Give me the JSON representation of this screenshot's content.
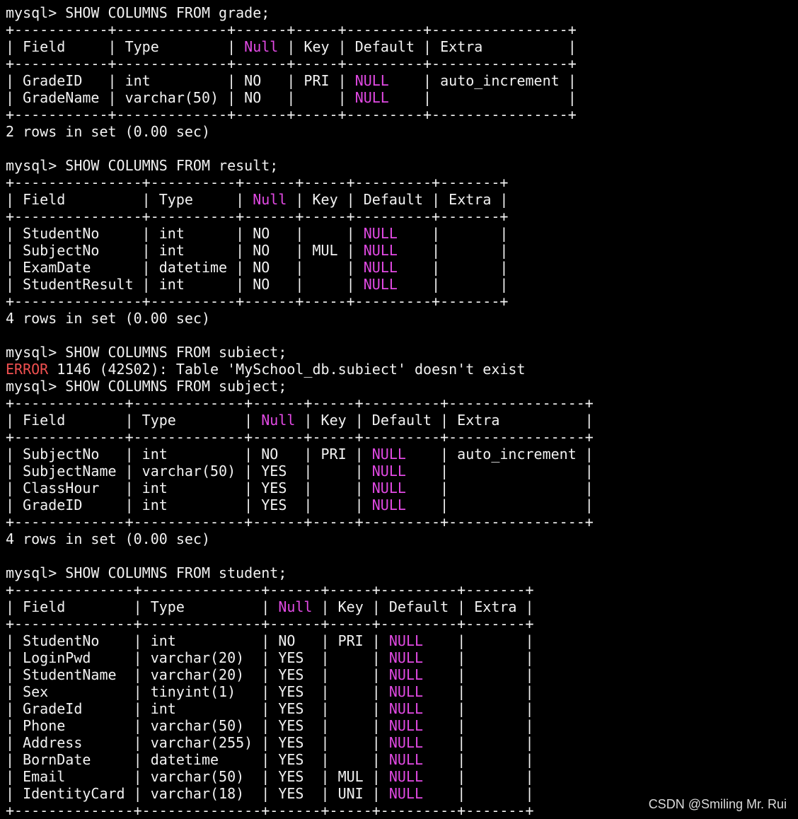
{
  "colors": {
    "background": "#000000",
    "text": "#f2f2f2",
    "null_highlight": "#e24ae4",
    "error_highlight": "#f05050"
  },
  "lines": [
    [
      {
        "t": "mysql> SHOW COLUMNS FROM grade;"
      }
    ],
    [
      {
        "t": "+-----------+-------------+------+-----+---------+----------------+"
      }
    ],
    [
      {
        "t": "| Field     | Type        | "
      },
      {
        "t": "Null",
        "c": "magenta"
      },
      {
        "t": " | Key | Default | Extra          |"
      }
    ],
    [
      {
        "t": "+-----------+-------------+------+-----+---------+----------------+"
      }
    ],
    [
      {
        "t": "| GradeID   | int         | NO   | PRI | "
      },
      {
        "t": "NULL",
        "c": "magenta"
      },
      {
        "t": "    | auto_increment |"
      }
    ],
    [
      {
        "t": "| GradeName | varchar(50) | NO   |     | "
      },
      {
        "t": "NULL",
        "c": "magenta"
      },
      {
        "t": "    |                |"
      }
    ],
    [
      {
        "t": "+-----------+-------------+------+-----+---------+----------------+"
      }
    ],
    [
      {
        "t": "2 rows in set (0.00 sec)"
      }
    ],
    [
      {
        "t": ""
      }
    ],
    [
      {
        "t": "mysql> SHOW COLUMNS FROM result;"
      }
    ],
    [
      {
        "t": "+---------------+----------+------+-----+---------+-------+"
      }
    ],
    [
      {
        "t": "| Field         | Type     | "
      },
      {
        "t": "Null",
        "c": "magenta"
      },
      {
        "t": " | Key | Default | Extra |"
      }
    ],
    [
      {
        "t": "+---------------+----------+------+-----+---------+-------+"
      }
    ],
    [
      {
        "t": "| StudentNo     | int      | NO   |     | "
      },
      {
        "t": "NULL",
        "c": "magenta"
      },
      {
        "t": "    |       |"
      }
    ],
    [
      {
        "t": "| SubjectNo     | int      | NO   | MUL | "
      },
      {
        "t": "NULL",
        "c": "magenta"
      },
      {
        "t": "    |       |"
      }
    ],
    [
      {
        "t": "| ExamDate      | datetime | NO   |     | "
      },
      {
        "t": "NULL",
        "c": "magenta"
      },
      {
        "t": "    |       |"
      }
    ],
    [
      {
        "t": "| StudentResult | int      | NO   |     | "
      },
      {
        "t": "NULL",
        "c": "magenta"
      },
      {
        "t": "    |       |"
      }
    ],
    [
      {
        "t": "+---------------+----------+------+-----+---------+-------+"
      }
    ],
    [
      {
        "t": "4 rows in set (0.00 sec)"
      }
    ],
    [
      {
        "t": ""
      }
    ],
    [
      {
        "t": "mysql> SHOW COLUMNS FROM subiect;"
      }
    ],
    [
      {
        "t": "ERROR",
        "c": "err-red"
      },
      {
        "t": " 1146 (42S02): Table 'MySchool_db.subiect' doesn't exist"
      }
    ],
    [
      {
        "t": "mysql> SHOW COLUMNS FROM subject;"
      }
    ],
    [
      {
        "t": "+-------------+-------------+------+-----+---------+----------------+"
      }
    ],
    [
      {
        "t": "| Field       | Type        | "
      },
      {
        "t": "Null",
        "c": "magenta"
      },
      {
        "t": " | Key | Default | Extra          |"
      }
    ],
    [
      {
        "t": "+-------------+-------------+------+-----+---------+----------------+"
      }
    ],
    [
      {
        "t": "| SubjectNo   | int         | NO   | PRI | "
      },
      {
        "t": "NULL",
        "c": "magenta"
      },
      {
        "t": "    | auto_increment |"
      }
    ],
    [
      {
        "t": "| SubjectName | varchar(50) | YES  |     | "
      },
      {
        "t": "NULL",
        "c": "magenta"
      },
      {
        "t": "    |                |"
      }
    ],
    [
      {
        "t": "| ClassHour   | int         | YES  |     | "
      },
      {
        "t": "NULL",
        "c": "magenta"
      },
      {
        "t": "    |                |"
      }
    ],
    [
      {
        "t": "| GradeID     | int         | YES  |     | "
      },
      {
        "t": "NULL",
        "c": "magenta"
      },
      {
        "t": "    |                |"
      }
    ],
    [
      {
        "t": "+-------------+-------------+------+-----+---------+----------------+"
      }
    ],
    [
      {
        "t": "4 rows in set (0.00 sec)"
      }
    ],
    [
      {
        "t": ""
      }
    ],
    [
      {
        "t": "mysql> SHOW COLUMNS FROM student;"
      }
    ],
    [
      {
        "t": "+--------------+--------------+------+-----+---------+-------+"
      }
    ],
    [
      {
        "t": "| Field        | Type         | "
      },
      {
        "t": "Null",
        "c": "magenta"
      },
      {
        "t": " | Key | Default | Extra |"
      }
    ],
    [
      {
        "t": "+--------------+--------------+------+-----+---------+-------+"
      }
    ],
    [
      {
        "t": "| StudentNo    | int          | NO   | PRI | "
      },
      {
        "t": "NULL",
        "c": "magenta"
      },
      {
        "t": "    |       |"
      }
    ],
    [
      {
        "t": "| LoginPwd     | varchar(20)  | YES  |     | "
      },
      {
        "t": "NULL",
        "c": "magenta"
      },
      {
        "t": "    |       |"
      }
    ],
    [
      {
        "t": "| StudentName  | varchar(20)  | YES  |     | "
      },
      {
        "t": "NULL",
        "c": "magenta"
      },
      {
        "t": "    |       |"
      }
    ],
    [
      {
        "t": "| Sex          | tinyint(1)   | YES  |     | "
      },
      {
        "t": "NULL",
        "c": "magenta"
      },
      {
        "t": "    |       |"
      }
    ],
    [
      {
        "t": "| GradeId      | int          | YES  |     | "
      },
      {
        "t": "NULL",
        "c": "magenta"
      },
      {
        "t": "    |       |"
      }
    ],
    [
      {
        "t": "| Phone        | varchar(50)  | YES  |     | "
      },
      {
        "t": "NULL",
        "c": "magenta"
      },
      {
        "t": "    |       |"
      }
    ],
    [
      {
        "t": "| Address      | varchar(255) | YES  |     | "
      },
      {
        "t": "NULL",
        "c": "magenta"
      },
      {
        "t": "    |       |"
      }
    ],
    [
      {
        "t": "| BornDate     | datetime     | YES  |     | "
      },
      {
        "t": "NULL",
        "c": "magenta"
      },
      {
        "t": "    |       |"
      }
    ],
    [
      {
        "t": "| Email        | varchar(50)  | YES  | MUL | "
      },
      {
        "t": "NULL",
        "c": "magenta"
      },
      {
        "t": "    |       |"
      }
    ],
    [
      {
        "t": "| IdentityCard | varchar(18)  | YES  | UNI | "
      },
      {
        "t": "NULL",
        "c": "magenta"
      },
      {
        "t": "    |       |"
      }
    ],
    [
      {
        "t": "+--------------+--------------+------+-----+---------+-------+"
      }
    ]
  ],
  "watermark": "CSDN @Smiling Mr. Rui"
}
